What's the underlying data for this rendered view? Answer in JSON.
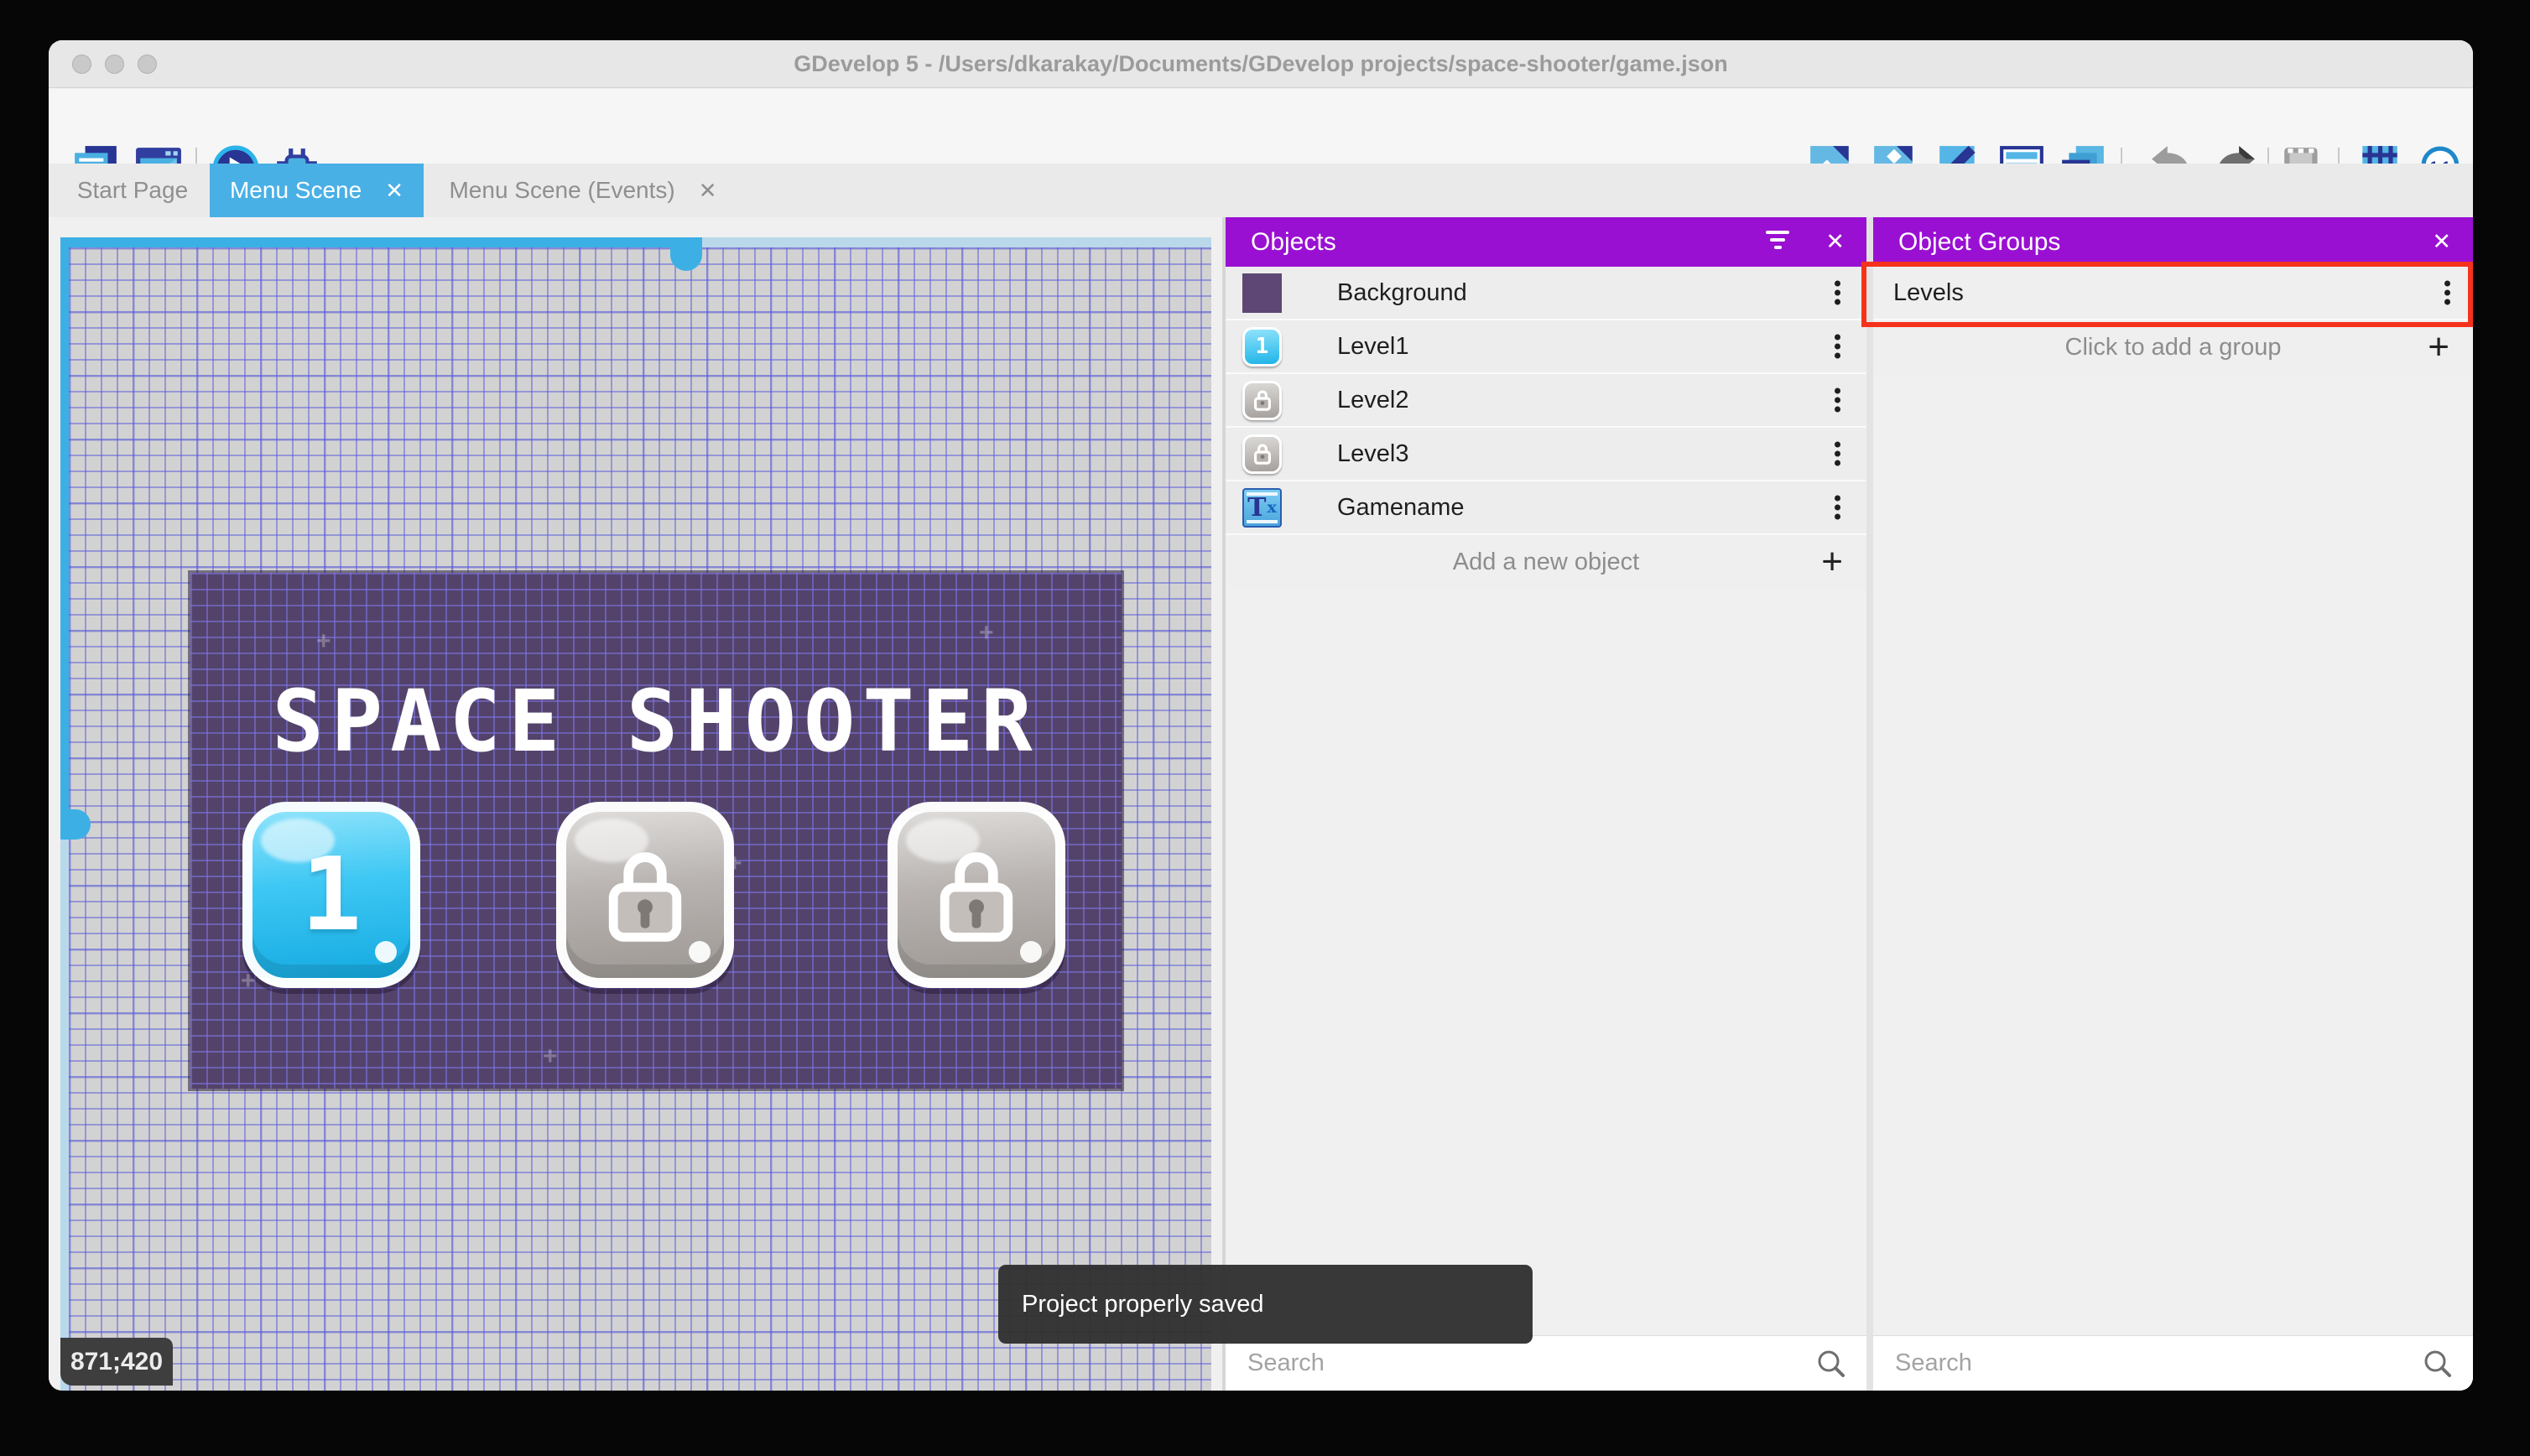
{
  "window_title": "GDevelop 5 - /Users/dkarakay/Documents/GDevelop projects/space-shooter/game.json",
  "traffic_lights": [
    "close",
    "minimize",
    "maximize"
  ],
  "toolbar": {
    "left_icons": [
      "project-manager-icon",
      "scene-editor-icon",
      "play-icon",
      "debug-icon"
    ],
    "right_icons": [
      "objects-editor-icon",
      "object-groups-editor-icon",
      "properties-icon",
      "instances-list-icon",
      "layers-icon",
      "undo-icon",
      "redo-icon",
      "window-mask-icon",
      "grid-icon",
      "zoom-1-1-icon"
    ]
  },
  "tabs": [
    {
      "label": "Start Page",
      "active": false,
      "closable": false
    },
    {
      "label": "Menu Scene",
      "active": true,
      "closable": true
    },
    {
      "label": "Menu Scene (Events)",
      "active": false,
      "closable": true
    }
  ],
  "canvas": {
    "coordinates_badge": "871;420",
    "scene": {
      "title": "SPACE SHOOTER",
      "buttons": [
        {
          "label": "1",
          "state": "unlocked"
        },
        {
          "label": "",
          "state": "locked"
        },
        {
          "label": "",
          "state": "locked"
        }
      ]
    }
  },
  "objects_panel": {
    "title": "Objects",
    "items": [
      {
        "name": "Background",
        "thumb": "purple-square"
      },
      {
        "name": "Level1",
        "thumb": "blue-button-1"
      },
      {
        "name": "Level2",
        "thumb": "gray-lock-button"
      },
      {
        "name": "Level3",
        "thumb": "gray-lock-button"
      },
      {
        "name": "Gamename",
        "thumb": "text-object"
      }
    ],
    "add_label": "Add a new object",
    "search_placeholder": "Search"
  },
  "object_groups_panel": {
    "title": "Object Groups",
    "groups": [
      {
        "name": "Levels",
        "highlighted": true
      }
    ],
    "add_label": "Click to add a group",
    "search_placeholder": "Search"
  },
  "toast": {
    "message": "Project properly saved"
  },
  "colors": {
    "accent_blue": "#49b0e5",
    "panel_header_purple": "#9a10d2",
    "highlight_red": "#f5321b",
    "scene_purple": "#53436a",
    "toast_bg": "#323232",
    "canvas_gray": "#d2d2d2"
  }
}
